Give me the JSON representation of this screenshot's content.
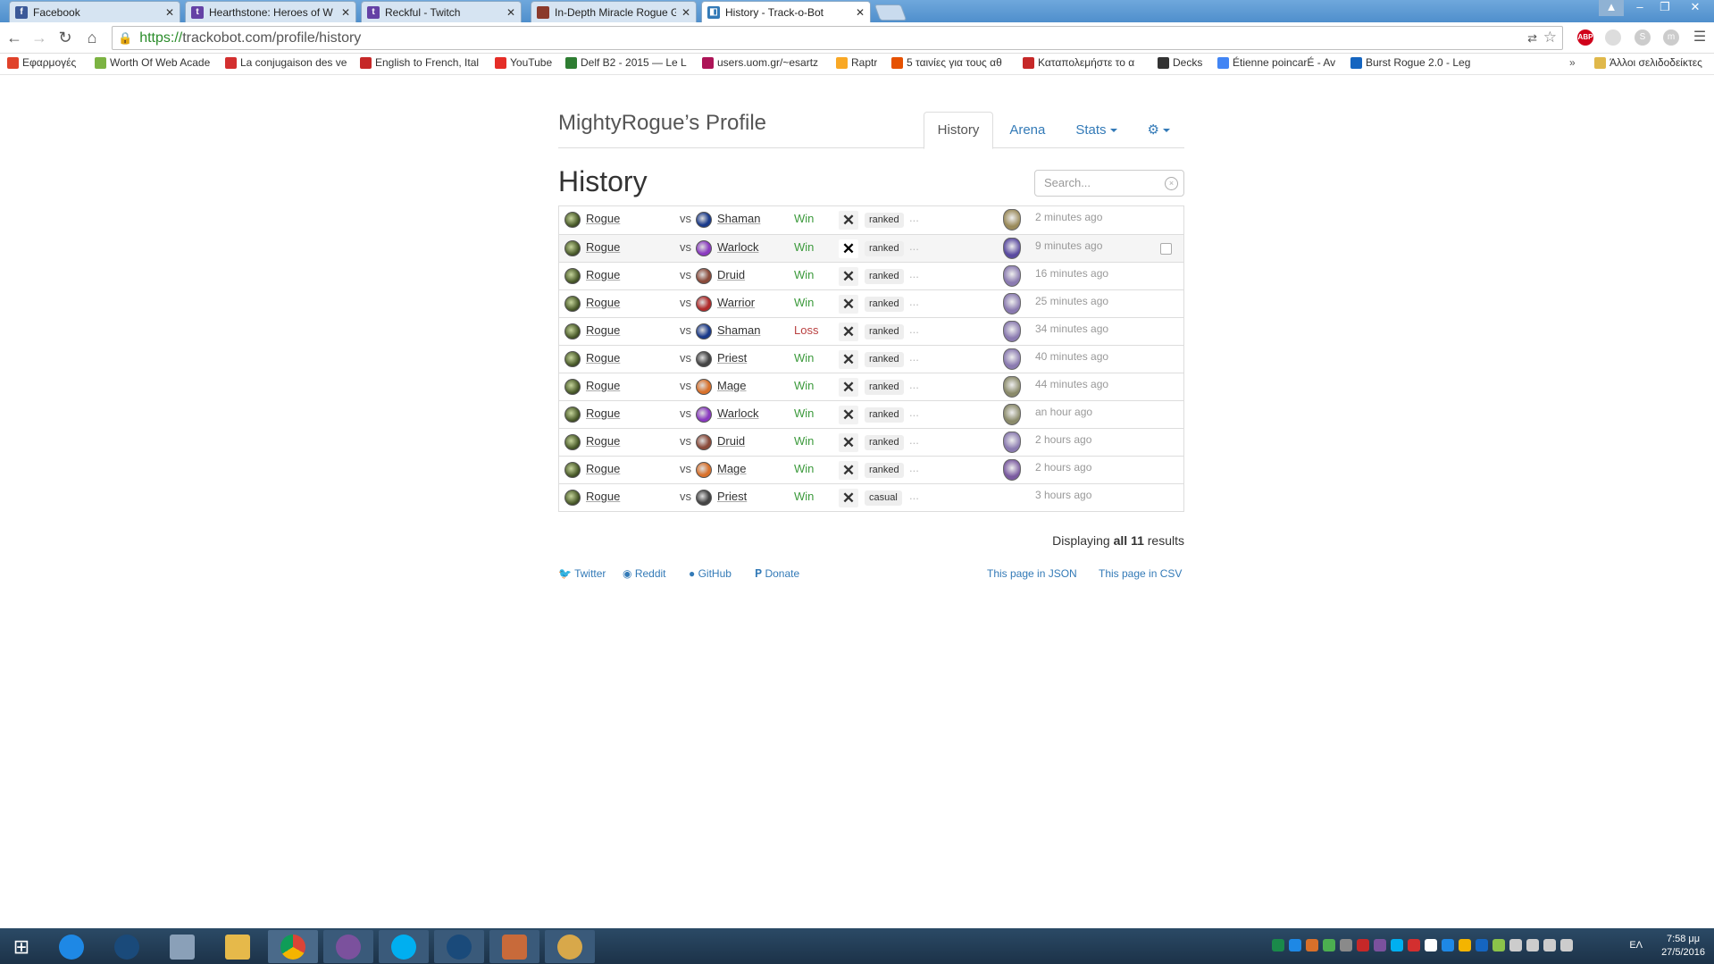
{
  "browser": {
    "tabs": [
      {
        "title": "Facebook",
        "color": "#3b5998",
        "glyph": "f"
      },
      {
        "title": "Hearthstone: Heroes of W",
        "color": "#6441a5",
        "glyph": "t"
      },
      {
        "title": "Reckful - Twitch",
        "color": "#6441a5",
        "glyph": "t"
      },
      {
        "title": "In-Depth Miracle Rogue G",
        "color": "#8b3a2b",
        "glyph": ""
      },
      {
        "title": "History - Track-o-Bot",
        "color": "#337ab7",
        "glyph": "◧"
      }
    ],
    "url_https": "https://",
    "url_rest": "trackobot.com/profile/history",
    "bookmarks": [
      {
        "label": "Εφαρμογές",
        "color": "#e0422a"
      },
      {
        "label": "Worth Of Web Acade",
        "color": "#7cb342"
      },
      {
        "label": "La conjugaison des ve",
        "color": "#d32f2f"
      },
      {
        "label": "English to French, Ital",
        "color": "#c62828"
      },
      {
        "label": "YouTube",
        "color": "#e52d27"
      },
      {
        "label": "Delf B2 - 2015 — Le L",
        "color": "#2e7d32"
      },
      {
        "label": "users.uom.gr/~esartz",
        "color": "#ad1457"
      },
      {
        "label": "Raptr",
        "color": "#f9a825"
      },
      {
        "label": "5 ταινίες για τους αθ",
        "color": "#e65100"
      },
      {
        "label": "Καταπολεμήστε το α",
        "color": "#c62828"
      },
      {
        "label": "Decks",
        "color": "#333333"
      },
      {
        "label": "Étienne poincarÉ - Av",
        "color": "#4285f4"
      },
      {
        "label": "Burst Rogue 2.0 - Leg",
        "color": "#1565c0"
      }
    ],
    "other_bookmarks": "Άλλοι σελιδοδείκτες",
    "more_bookmarks": "»"
  },
  "page": {
    "profile_title": "MightyRogue’s Profile",
    "nav": {
      "history": "History",
      "arena": "Arena",
      "stats": "Stats",
      "settings_icon": "gear-icon"
    },
    "heading": "History",
    "search_placeholder": "Search...",
    "games": [
      {
        "hero": "Rogue",
        "vs": "vs",
        "opponent": "Shaman",
        "result": "Win",
        "mode": "ranked",
        "time": "2 minutes ago",
        "opp_color": "#1a3a8a",
        "rank_color": "#9a8a5a"
      },
      {
        "hero": "Rogue",
        "vs": "vs",
        "opponent": "Warlock",
        "result": "Win",
        "mode": "ranked",
        "time": "9 minutes ago",
        "opp_color": "#8a3ac0",
        "rank_color": "#5a4aa0"
      },
      {
        "hero": "Rogue",
        "vs": "vs",
        "opponent": "Druid",
        "result": "Win",
        "mode": "ranked",
        "time": "16 minutes ago",
        "opp_color": "#8a4a3a",
        "rank_color": "#8a7ab0"
      },
      {
        "hero": "Rogue",
        "vs": "vs",
        "opponent": "Warrior",
        "result": "Win",
        "mode": "ranked",
        "time": "25 minutes ago",
        "opp_color": "#b02a2a",
        "rank_color": "#8a7ab0"
      },
      {
        "hero": "Rogue",
        "vs": "vs",
        "opponent": "Shaman",
        "result": "Loss",
        "mode": "ranked",
        "time": "34 minutes ago",
        "opp_color": "#1a3a8a",
        "rank_color": "#8a7ab0"
      },
      {
        "hero": "Rogue",
        "vs": "vs",
        "opponent": "Priest",
        "result": "Win",
        "mode": "ranked",
        "time": "40 minutes ago",
        "opp_color": "#444444",
        "rank_color": "#8a7ab0"
      },
      {
        "hero": "Rogue",
        "vs": "vs",
        "opponent": "Mage",
        "result": "Win",
        "mode": "ranked",
        "time": "44 minutes ago",
        "opp_color": "#d8702a",
        "rank_color": "#8a8a6a"
      },
      {
        "hero": "Rogue",
        "vs": "vs",
        "opponent": "Warlock",
        "result": "Win",
        "mode": "ranked",
        "time": "an hour ago",
        "opp_color": "#8a3ac0",
        "rank_color": "#8a8a6a"
      },
      {
        "hero": "Rogue",
        "vs": "vs",
        "opponent": "Druid",
        "result": "Win",
        "mode": "ranked",
        "time": "2 hours ago",
        "opp_color": "#8a4a3a",
        "rank_color": "#8a7ab0"
      },
      {
        "hero": "Rogue",
        "vs": "vs",
        "opponent": "Mage",
        "result": "Win",
        "mode": "ranked",
        "time": "2 hours ago",
        "opp_color": "#d8702a",
        "rank_color": "#7a5aa0"
      },
      {
        "hero": "Rogue",
        "vs": "vs",
        "opponent": "Priest",
        "result": "Win",
        "mode": "casual",
        "time": "3 hours ago",
        "opp_color": "#444444",
        "rank_color": ""
      }
    ],
    "results_prefix": "Displaying",
    "results_bold": "all 11",
    "results_suffix": "results",
    "footer": {
      "twitter": "Twitter",
      "reddit": "Reddit",
      "github": "GitHub",
      "donate": "Donate",
      "json": "This page in JSON",
      "csv": "This page in CSV"
    }
  },
  "taskbar": {
    "lang": "EΛ",
    "time": "7:58 μμ",
    "date": "27/5/2016"
  }
}
